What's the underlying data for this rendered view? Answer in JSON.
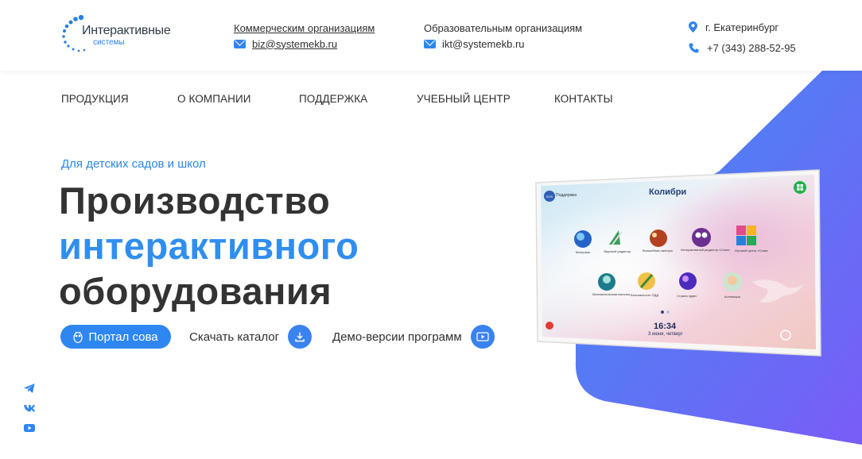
{
  "brand": {
    "name": "Интерактивные",
    "sub": "системы"
  },
  "header": {
    "biz": {
      "title": "Коммерческим организациям",
      "email": "biz@systemekb.ru"
    },
    "edu": {
      "title": "Образовательным организациям",
      "email": "ikt@systemekb.ru"
    },
    "city": "г. Екатеринбург",
    "phone": "+7 (343) 288-52-95"
  },
  "nav": {
    "items": [
      "ПРОДУКЦИЯ",
      "О КОМПАНИИ",
      "ПОДДЕРЖКА",
      "УЧЕБНЫЙ ЦЕНТР",
      "КОНТАКТЫ"
    ]
  },
  "hero": {
    "kicker": "Для детских садов и школ",
    "line1": "Производство",
    "line2": "интерактивного",
    "line3": "оборудования",
    "portal_button": "Портал сова",
    "catalog_link": "Скачать каталог",
    "demo_link": "Демо-версии программ"
  },
  "screen": {
    "title": "Колибри",
    "time": "16:34",
    "date": "3 июня, четверг",
    "sos_label": "SOS",
    "sos_text": "Поддержка",
    "apps": [
      "Материки",
      "Ярусный редактор",
      "Волшебная палитра",
      "Интерактивный редактор «Сова»",
      "Игровой центр «Сова»",
      "Математическая копилка",
      "Безопасность ПДД",
      "Страна чудес",
      "Коллекция"
    ]
  },
  "colors": {
    "accent": "#2E86F1",
    "gradient_start": "#3A86F0",
    "gradient_end": "#7B5CF6",
    "text": "#2F2F2F"
  },
  "icons": {
    "social": [
      "telegram-icon",
      "vk-icon",
      "youtube-icon"
    ]
  }
}
